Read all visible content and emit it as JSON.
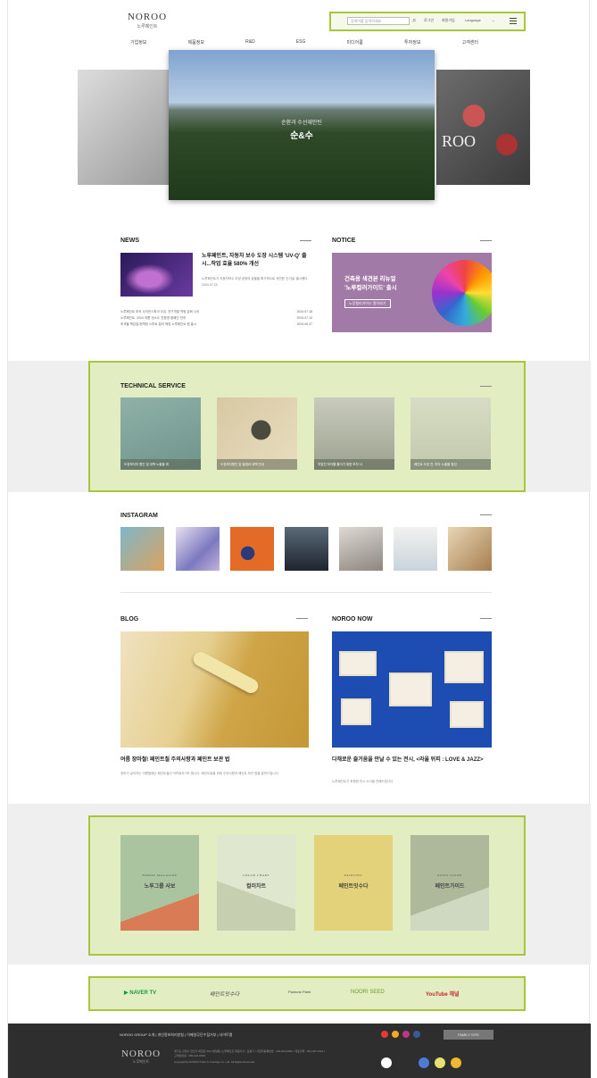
{
  "header": {
    "logo_en": "NOROO",
    "logo_ko": "노루페인트",
    "search_placeholder": "검색어를 입력하세요",
    "links": [
      "로그인",
      "회원가입"
    ],
    "language_label": "Language"
  },
  "nav": [
    "기업정보",
    "제품정보",
    "R&D",
    "ESG",
    "미디어룸",
    "투자정보",
    "고객센터"
  ],
  "hero": {
    "subtitle": "순환과 수선재안틴",
    "title": "순&수",
    "side_text": "ROO"
  },
  "news": {
    "title": "NEWS",
    "headline": "노루페인트, 자동차 보수 도장 시스템 'UV-Q' 출시...작업 효율 580% 개선",
    "desc": "노루페인트가 자동차보수 도장 공정의 효율을 획기적으로 개선한 '신기술' 출시했다.",
    "date": "2024.07.23",
    "list": [
      {
        "text": "노루페인트 마곡 사이언스파크 오픈, 연구개발 역량 강화 나서",
        "date": "2024.07.18"
      },
      {
        "text": "노루페인트, 2024 여름 '순&수' 친환경 캠페인 전개",
        "date": "2024.07.10"
      },
      {
        "text": "조색을 책임질 완벽한 스마트 컬러 매칭 노루페인트 앱 출시",
        "date": "2024.06.27"
      }
    ]
  },
  "notice": {
    "title": "NOTICE",
    "banner_line1": "건축용 색견본 리뉴얼",
    "banner_line2": "'노루컬러가이드' 출시",
    "banner_button": "노루컬러가이드 알아보기"
  },
  "technical_service": {
    "title": "TECHNICAL SERVICE",
    "cards": [
      "도장하자의 원인 및 대책 노출을 위",
      "도장하자원인 및 발생과 대책 안내",
      "작업전 하자를 줄이기 위한 조치 사",
      "페인트 도장 전, 하자 노출을 점검"
    ]
  },
  "instagram": {
    "title": "INSTAGRAM"
  },
  "blog": {
    "title": "BLOG",
    "post_title": "여름 장마철! 페인트칠 주의사항과 페인트 보관 법",
    "post_desc": "장마가 길어지는 여름철에는 페인트칠이 어려워지기도 합니다. 페인트칠을 위한 주의사항과 페인트 보관 법을 알려드립니다."
  },
  "noroo_now": {
    "title": "NOROO NOW",
    "post_title": "다채로운 즐거움을 만날 수 있는 전시, <라울 뒤피 : LOVE & JAZZ>",
    "post_desc": "노루페인트가 후원한 전시 소식을 전해드립니다."
  },
  "magazines": [
    {
      "category": "NOROO MAGAZINE",
      "name": "노루그룹 사보"
    },
    {
      "category": "COLOR CHART",
      "name": "컬러차트"
    },
    {
      "category": "PAINTING",
      "name": "페인트잇수다"
    },
    {
      "category": "PAINT GUIDE",
      "name": "페인트가이드"
    }
  ],
  "partners": [
    "NAVER TV",
    "페인트잇수다",
    "Pantone Paint",
    "NOORI SEED",
    "YouTube 채널"
  ],
  "footer": {
    "nav": "NOROO GROUP 소개  |  개인정보처리방침  |  이메일무단수집거부  |  사이트맵",
    "logo_en": "NOROO",
    "logo_ko": "노루페인트",
    "address": "경기도 안양시 만안구 박달로 351 (박달동) 노루페인트 대표이사 : 김용기 / 사업자등록번호 : 130-86-00000 / 대표전화 : 031-467-6114 / 고객상담실 : 080-022-8000",
    "copyright": "Copyright(c) NOROO Paint & Coatings Co.,Ltd. All Rights Reserved.",
    "family_site": "FAMILY SITE"
  }
}
